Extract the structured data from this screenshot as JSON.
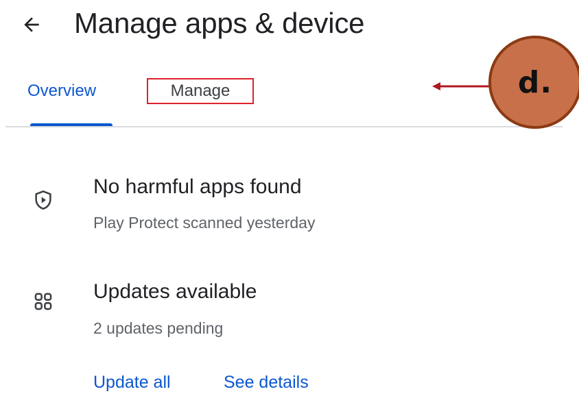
{
  "header": {
    "back_icon": "arrow-back-icon",
    "title": "Manage apps & device"
  },
  "tabs": [
    {
      "label": "Overview",
      "selected": true
    },
    {
      "label": "Manage",
      "selected": false
    }
  ],
  "rows": [
    {
      "icon": "play-protect-shield-icon",
      "title": "No harmful apps found",
      "subtitle": "Play Protect scanned yesterday"
    },
    {
      "icon": "apps-grid-icon",
      "title": "Updates available",
      "subtitle": "2 updates pending"
    }
  ],
  "actions": {
    "update_all": "Update all",
    "see_details": "See details"
  },
  "annotation": {
    "label": "d."
  },
  "colors": {
    "accent": "#0b57d0",
    "highlight_box": "#e0202a",
    "annotation_fill": "#c8704a",
    "annotation_border": "#8b3a14",
    "annotation_arrow": "#b0171f"
  }
}
